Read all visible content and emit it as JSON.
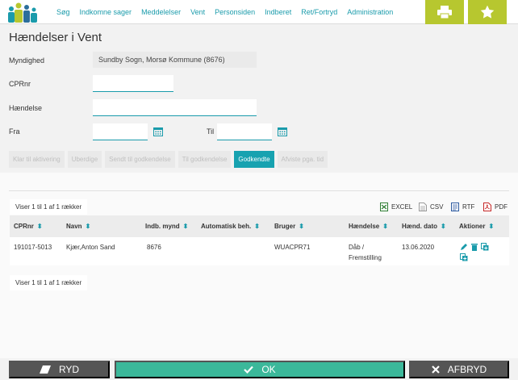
{
  "nav": {
    "items": [
      "Søg",
      "Indkomne sager",
      "Meddelelser",
      "Vent",
      "Personsiden",
      "Indberet",
      "Ret/Fortryd",
      "Administration"
    ],
    "icons": [
      "printer-icon",
      "star-icon"
    ]
  },
  "page": {
    "title": "Hændelser i Vent"
  },
  "form": {
    "myndighed_label": "Myndighed",
    "myndighed_value": "Sundby Sogn, Morsø Kommune (8676)",
    "cprnr_label": "CPRnr",
    "cprnr_value": "",
    "haendelse_label": "Hændelse",
    "haendelse_value": "",
    "fra_label": "Fra",
    "fra_value": "",
    "til_label": "Til",
    "til_value": ""
  },
  "filters": [
    {
      "label": "Klar til aktivering",
      "active": false
    },
    {
      "label": "Uberdige",
      "active": false
    },
    {
      "label": "Sendt til godkendelse",
      "active": false
    },
    {
      "label": "Til godkendelse",
      "active": false
    },
    {
      "label": "Godkendte",
      "active": true
    },
    {
      "label": "Afviste pga. tid",
      "active": false
    }
  ],
  "table": {
    "rows_info_top": "Viser 1 til 1 af 1 rækker",
    "rows_info_bottom": "Viser 1 til 1 af 1 rækker",
    "exports": [
      "EXCEL",
      "CSV",
      "RTF",
      "PDF"
    ],
    "columns": [
      "CPRnr",
      "Navn",
      "Indb. mynd",
      "Automatisk beh.",
      "Bruger",
      "Hændelse",
      "Hænd. dato",
      "Aktioner"
    ],
    "rows": [
      {
        "cprnr": "191017-5013",
        "navn": "Kjær,Anton Sand",
        "indb_mynd": "8676",
        "automatisk": "",
        "bruger": "WUACPR71",
        "haendelse_line1": "Dåb /",
        "haendelse_line2": "Fremstilling",
        "dato": "13.06.2020"
      }
    ]
  },
  "buttons": {
    "ryd": "RYD",
    "ok": "OK",
    "afbryd": "AFBRYD"
  },
  "colors": {
    "accent": "#1a9bab",
    "nav_button": "#b7c72f",
    "ok": "#3bb89a",
    "dark_button": "#555555"
  }
}
